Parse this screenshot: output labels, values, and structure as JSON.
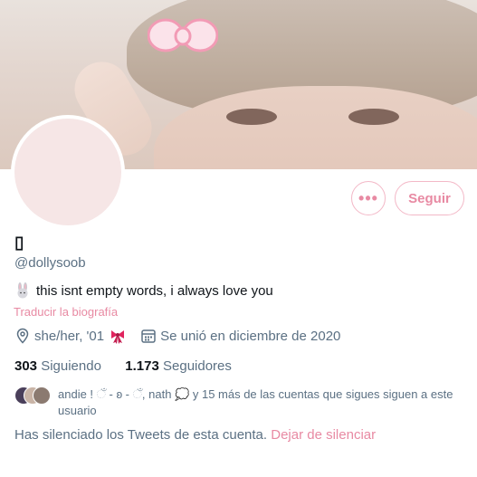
{
  "profile": {
    "display_name": "▯",
    "handle": "@dollysoob",
    "bio": "this isnt empty words, i always love you",
    "translate_bio_link": "Traducir la biografía",
    "pronouns": "she/her, '01",
    "joined": "Se unió en diciembre de 2020",
    "following_count": "303",
    "following_label": "Siguiendo",
    "followers_count": "1.173",
    "followers_label": "Seguidores",
    "followers_you_know": "andie ! ઁ - ʚ - ઁ, nath 💭 y 15 más de las cuentas que sigues siguen a este usuario",
    "muted_notice": "Has silenciado los Tweets de esta cuenta.",
    "unmute_link": "Dejar de silenciar"
  },
  "actions": {
    "more_label": "•••",
    "follow_label": "Seguir"
  },
  "icons": {
    "bio_emoji": "bunny-icon",
    "location": "location-pin-icon",
    "ribbon": "ribbon-icon",
    "calendar": "calendar-icon",
    "banner_decor": "hair-bow-icon"
  },
  "colors": {
    "accent": "#e88aa3",
    "accent_border": "#f3b8c7",
    "secondary_text": "#5b7083",
    "avatar_fill": "#f6e6e6"
  }
}
